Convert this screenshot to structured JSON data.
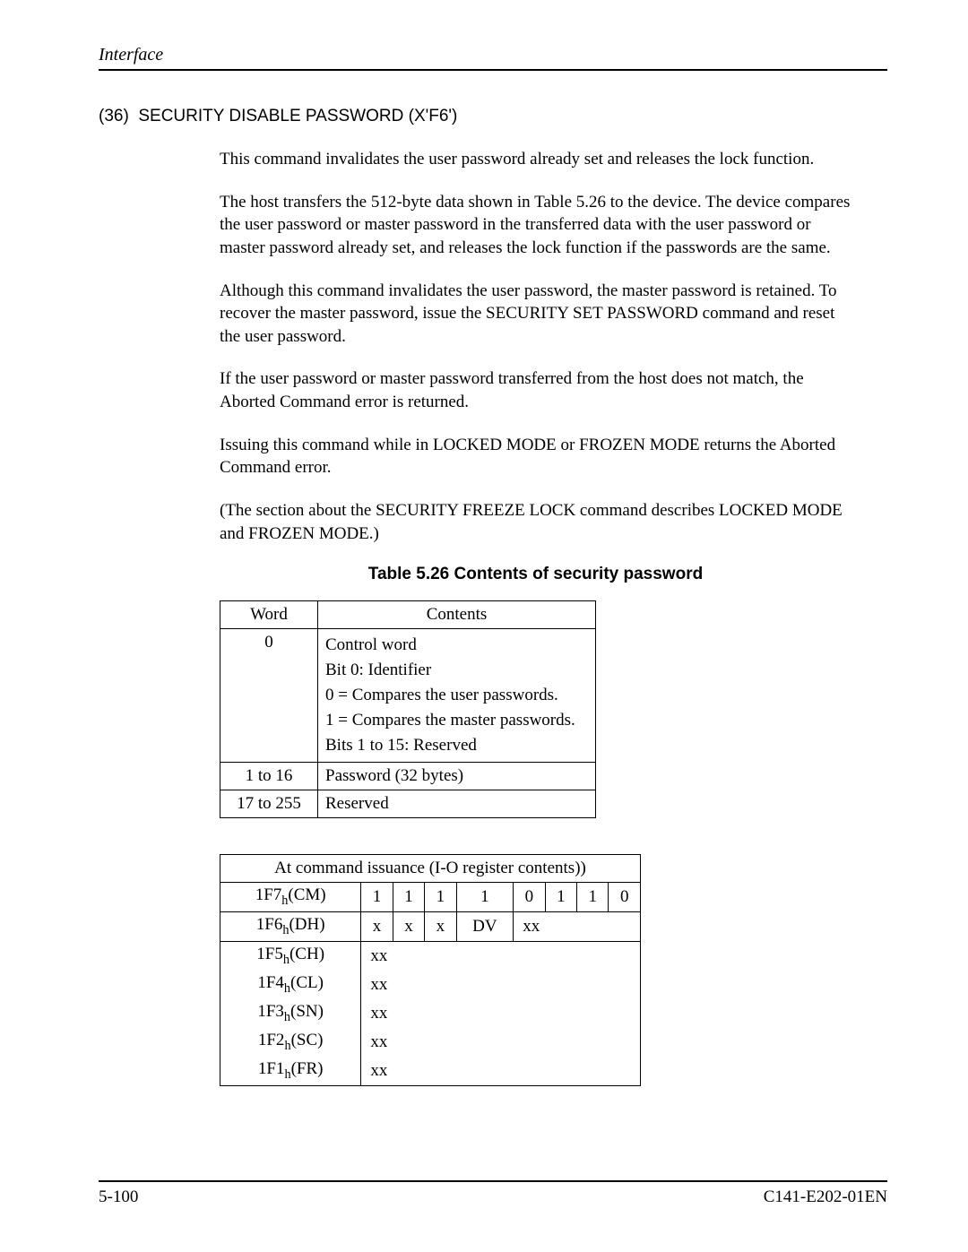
{
  "header": {
    "running": "Interface"
  },
  "section": {
    "num": "(36)",
    "title": "SECURITY DISABLE PASSWORD (X'F6')"
  },
  "paragraphs": {
    "p1": "This command invalidates the user password already set and releases the lock function.",
    "p2": "The host transfers the 512-byte data shown in Table 5.26 to the device.  The device compares the user password or master password in the transferred data with the user password or master password already set, and releases the lock function if the passwords are the same.",
    "p3": "Although this command invalidates the user password, the master password is retained.  To recover the master password, issue the SECURITY SET PASSWORD command and reset the user password.",
    "p4": "If the user password or master password transferred from the host does not match, the Aborted Command error is returned.",
    "p5": "Issuing this command while in LOCKED MODE or FROZEN MODE returns the Aborted Command error.",
    "p6": "(The section about the SECURITY FREEZE LOCK command describes LOCKED MODE and FROZEN MODE.)"
  },
  "table1": {
    "caption": "Table 5.26  Contents of security password",
    "headers": {
      "word": "Word",
      "contents": "Contents"
    },
    "rows": {
      "r0_word": "0",
      "r0_l1": "Control word",
      "r0_l2": "Bit 0:  Identifier",
      "r0_l3": "0 = Compares the user passwords.",
      "r0_l4": "1 = Compares the master passwords.",
      "r0_l5": "Bits 1 to 15:  Reserved",
      "r1_word": "1 to 16",
      "r1_contents": "Password (32 bytes)",
      "r2_word": "17 to 255",
      "r2_contents": "Reserved"
    }
  },
  "table2": {
    "title": "At command issuance (I-O register contents))",
    "regs": {
      "cm": "1F7",
      "cm_suf": "(CM)",
      "dh": "1F6",
      "dh_suf": "(DH)",
      "ch": "1F5",
      "ch_suf": "(CH)",
      "cl": "1F4",
      "cl_suf": "(CL)",
      "sn": "1F3",
      "sn_suf": "(SN)",
      "sc": "1F2",
      "sc_suf": "(SC)",
      "fr": "1F1",
      "fr_suf": "(FR)"
    },
    "cm_bits": [
      "1",
      "1",
      "1",
      "1",
      "0",
      "1",
      "1",
      "0"
    ],
    "dh_bits": [
      "x",
      "x",
      "x",
      "DV",
      "xx"
    ],
    "xx": "xx"
  },
  "footer": {
    "page": "5-100",
    "doc": "C141-E202-01EN"
  }
}
